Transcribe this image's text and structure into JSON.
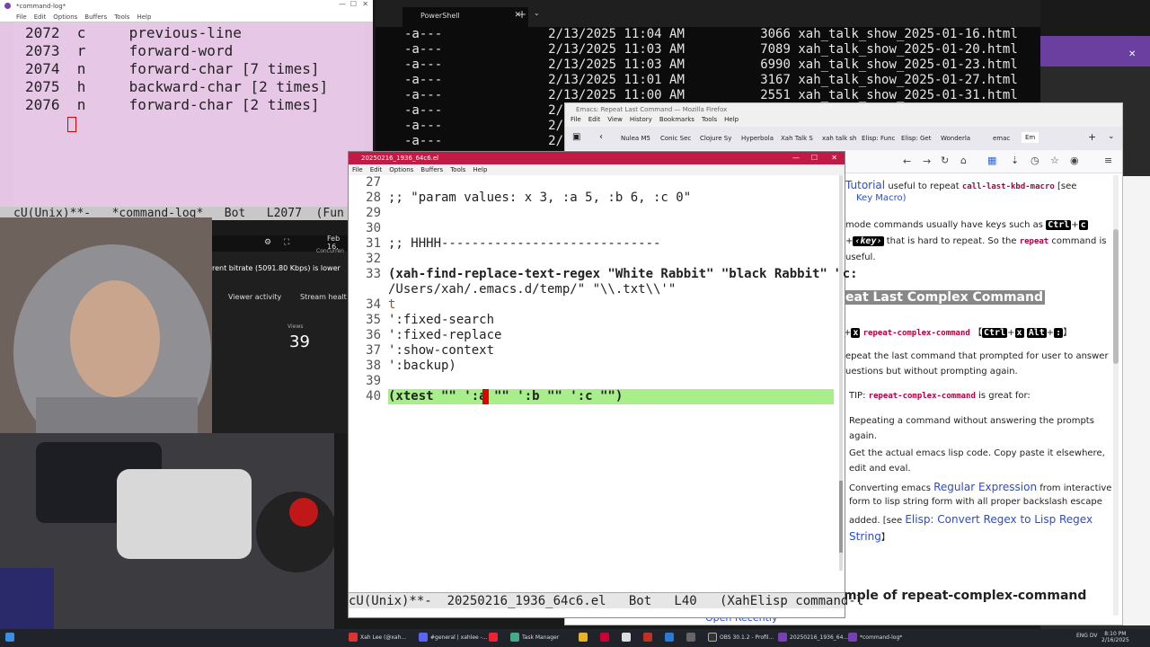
{
  "command_log": {
    "title": "*command-log*",
    "menu": [
      "File",
      "Edit",
      "Options",
      "Buffers",
      "Tools",
      "Help"
    ],
    "lines": [
      {
        "num": "2072",
        "key": "c",
        "cmd": "previous-line"
      },
      {
        "num": "2073",
        "key": "r",
        "cmd": "forward-word"
      },
      {
        "num": "2074",
        "key": "n",
        "cmd": "forward-char [7 times]"
      },
      {
        "num": "2075",
        "key": "h",
        "cmd": "backward-char [2 times]"
      },
      {
        "num": "2076",
        "key": "n",
        "cmd": "forward-char [2 times]"
      }
    ],
    "modeline": "cU(Unix)**-   *command-log*   Bot   L2077  (Fun"
  },
  "powershell": {
    "tab_label": "PowerShell",
    "rows": [
      {
        "mode": "-a---",
        "date": "2/13/2025 11:04 AM",
        "size": "3066",
        "name": "xah_talk_show_2025-01-16.html"
      },
      {
        "mode": "-a---",
        "date": "2/13/2025 11:03 AM",
        "size": "7089",
        "name": "xah_talk_show_2025-01-20.html"
      },
      {
        "mode": "-a---",
        "date": "2/13/2025 11:03 AM",
        "size": "6990",
        "name": "xah_talk_show_2025-01-23.html"
      },
      {
        "mode": "-a---",
        "date": "2/13/2025 11:01 AM",
        "size": "3167",
        "name": "xah_talk_show_2025-01-27.html"
      },
      {
        "mode": "-a---",
        "date": "2/13/2025 11:00 AM",
        "size": "2551",
        "name": "xah_talk_show_2025-01-31.html"
      },
      {
        "mode": "-a---",
        "date": "2/13/",
        "size": "",
        "name": ""
      },
      {
        "mode": "-a---",
        "date": "2/13/",
        "size": "",
        "name": ""
      },
      {
        "mode": "-a---",
        "date": "2/16/",
        "size": "",
        "name": ""
      }
    ]
  },
  "firefox": {
    "title": "Emacs: Repeat Last Command — Mozilla Firefox",
    "menu": [
      "File",
      "Edit",
      "View",
      "History",
      "Bookmarks",
      "Tools",
      "Help"
    ],
    "tabs": [
      "Nulea M5",
      "Conic Sec",
      "Clojure Sy",
      "Hyperbola",
      "Xah Talk S",
      "xah talk sh",
      "Elisp: Func",
      "Elisp: Get",
      "Wonderla",
      "emac",
      "Em"
    ],
    "page": {
      "tutorial_link": "Tutorial",
      "keymacro_link": "Key Macro)",
      "repeat_intro_a": "useful to repeat",
      "repeat_fn": "call-last-kbd-macro",
      "see": "[see",
      "minor_a": "mode commands usually have keys such as",
      "ctrl": "Ctrl",
      "c": "c",
      "key": "‹key›",
      "minor_b": "that is hard to repeat. So the",
      "repeat": "repeat",
      "minor_c": "command is",
      "useful": "useful.",
      "heading1": "eat Last Complex Command",
      "x": "x",
      "rcc": "repeat-complex-command",
      "alt": "Alt",
      "colon": ":",
      "desc1": "epeat the last command that prompted for user to answer",
      "desc2": "uestions but without prompting again.",
      "tip": "TIP:",
      "tip_fn": "repeat-complex-command",
      "tip_b": "is great for:",
      "b1a": "Repeating a command without answering the prompts",
      "b1b": "again.",
      "b2a": "Get the actual emacs lisp code. Copy paste it elsewhere,",
      "b2b": "edit and eval.",
      "b3a": "Converting emacs",
      "b3link": "Regular Expression",
      "b3b": "from interactive",
      "b3c": "form to lisp string form with all proper backslash escape",
      "b3d": "added.",
      "b3see": "[see",
      "b3link2": "Elisp: Convert Regex to Lisp Regex",
      "b3link3": "String",
      "heading2": "mple of repeat-complex-command",
      "open_recently": "Open Recently"
    }
  },
  "emacs": {
    "title": "20250216_1936_64c6.el",
    "menu": [
      "File",
      "Edit",
      "Options",
      "Buffers",
      "Tools",
      "Help"
    ],
    "lines": [
      {
        "n": "27",
        "t": ""
      },
      {
        "n": "28",
        "t": ";; \"param values: x 3, :a 5, :b 6, :c 0\""
      },
      {
        "n": "29",
        "t": ""
      },
      {
        "n": "30",
        "t": ""
      },
      {
        "n": "31",
        "t": ";; HHHH-----------------------------"
      },
      {
        "n": "32",
        "t": ""
      },
      {
        "n": "33",
        "t": "(xah-find-replace-text-regex \"White Rabbit\" \"black Rabbit\" \"c:"
      },
      {
        "n": "",
        "t": "/Users/xah/.emacs.d/temp/\" \"\\\\.txt\\\\'\""
      },
      {
        "n": "34",
        "t": "t"
      },
      {
        "n": "35",
        "t": "':fixed-search"
      },
      {
        "n": "36",
        "t": "':fixed-replace"
      },
      {
        "n": "37",
        "t": "':show-context"
      },
      {
        "n": "38",
        "t": "':backup)"
      },
      {
        "n": "39",
        "t": ""
      },
      {
        "n": "40",
        "t": "(xtest \"\" ':a \"\" ':b \"\" ':c \"\")"
      }
    ],
    "modeline": "cU(Unix)**-  20250216_1936_64c6.el   Bot   L40   (XahElisp command-l"
  },
  "stream": {
    "bitrate": "rent bitrate (5091.80 Kbps) is lower",
    "viewer_activity": "Viewer activity",
    "stream_health": "Stream healt",
    "views_label": "Views",
    "views": "39",
    "concurrent": "Concurren",
    "date": "Feb 16,"
  },
  "taskbar": {
    "items": [
      "Xah Lee (@xah...",
      "#general | xahlee -...",
      "",
      "Task Manager",
      "",
      "",
      "",
      "",
      "OBS 30.1.2 - Profil...",
      "20250216_1936_64...",
      "*command-log*"
    ],
    "time": "8:10 PM",
    "date": "2/16/2025",
    "lang": "ENG DV"
  }
}
